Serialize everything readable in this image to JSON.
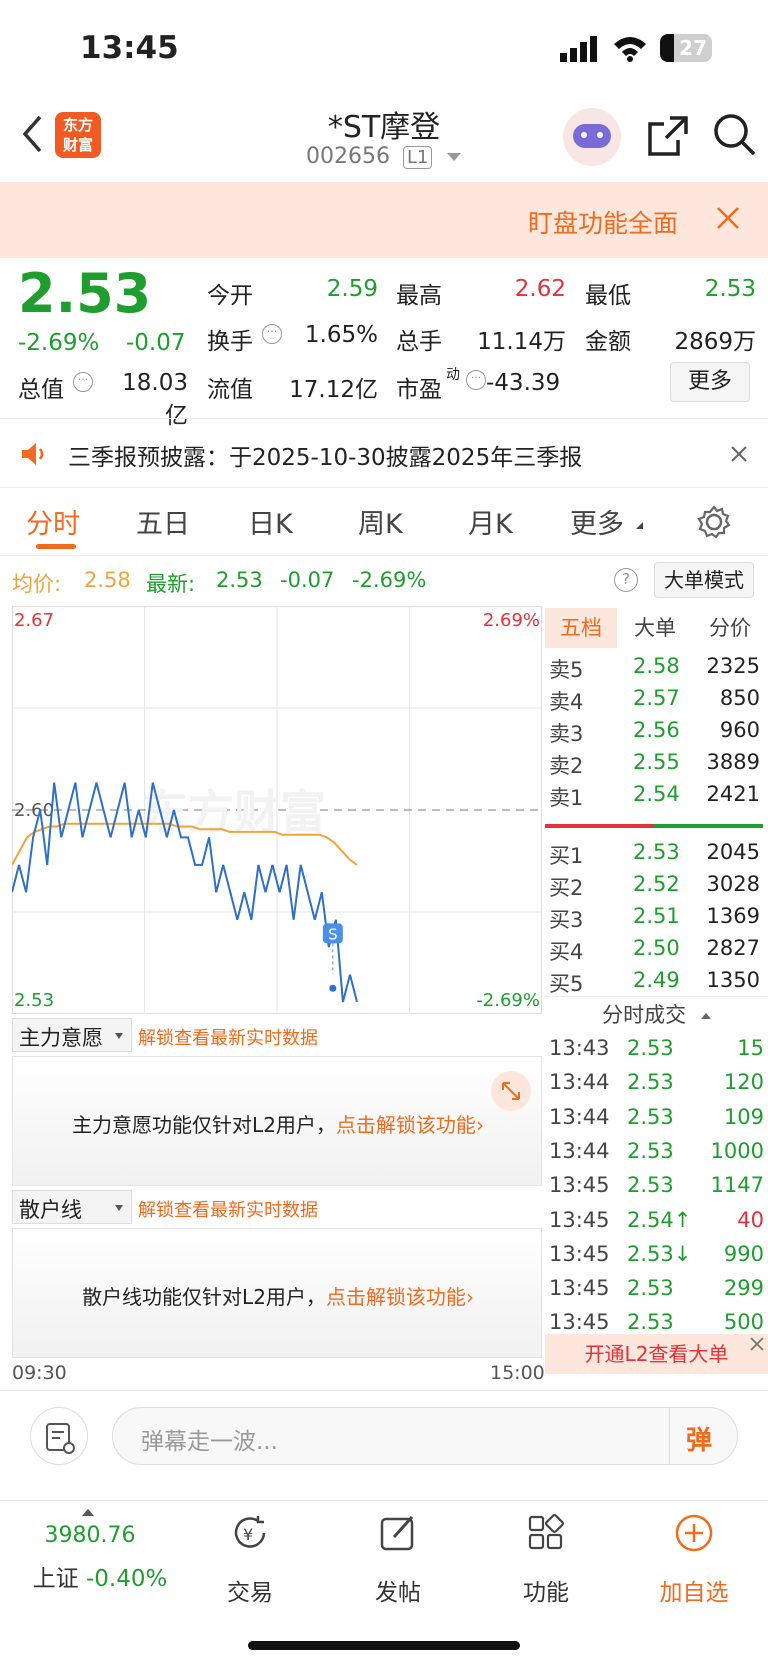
{
  "status": {
    "time": "13:45",
    "battery": "27"
  },
  "header": {
    "title": "*ST摩登",
    "code": "002656",
    "level": "L1",
    "logo_line1": "东方",
    "logo_line2": "财富"
  },
  "banner": {
    "text": "盯盘功能全面"
  },
  "quote": {
    "price": "2.53",
    "change_pct": "-2.69%",
    "change": "-0.07",
    "open_label": "今开",
    "open": "2.59",
    "high_label": "最高",
    "high": "2.62",
    "low_label": "最低",
    "low": "2.53",
    "turnover_label": "换手",
    "turnover": "1.65%",
    "volume_label": "总手",
    "volume": "11.14万",
    "amount_label": "金额",
    "amount": "2869万",
    "mktcap_label": "总值",
    "mktcap": "18.03亿",
    "float_label": "流值",
    "float": "17.12亿",
    "pe_label": "市盈",
    "pe_sup": "动",
    "pe": "-43.39",
    "more_label": "更多"
  },
  "notice": {
    "text": "三季报预披露：于2025-10-30披露2025年三季报"
  },
  "tabs": [
    "分时",
    "五日",
    "日K",
    "周K",
    "月K",
    "更多"
  ],
  "avgline": {
    "avg_label": "均价:",
    "avg": "2.58",
    "last_label": "最新:",
    "last": "2.53",
    "chg": "-0.07",
    "pct": "-2.69%",
    "mode_label": "大单模式"
  },
  "chart": {
    "top_price": "2.67",
    "top_pct": "2.69%",
    "mid_price": "2.60",
    "bottom_price": "2.53",
    "bottom_pct": "-2.69%",
    "start_time": "09:30",
    "end_time": "15:00",
    "watermark": "东方财富",
    "marker": "S"
  },
  "chart_data": {
    "type": "line",
    "ylim": [
      2.53,
      2.67
    ],
    "prev_close": 2.6,
    "series": [
      {
        "values": [
          2.57,
          2.58,
          2.57,
          2.59,
          2.6,
          2.58,
          2.61,
          2.59,
          2.6,
          2.61,
          2.59,
          2.6,
          2.61,
          2.6,
          2.59,
          2.6,
          2.61,
          2.59,
          2.6,
          2.59,
          2.61,
          2.6,
          2.59,
          2.6,
          2.59,
          2.59,
          2.58,
          2.58,
          2.59,
          2.57,
          2.58,
          2.57,
          2.56,
          2.57,
          2.56,
          2.58,
          2.57,
          2.58,
          2.57,
          2.58,
          2.56,
          2.58,
          2.57,
          2.56,
          2.57,
          2.55,
          2.56,
          2.53,
          2.54,
          2.53
        ]
      },
      {
        "values": [
          2.58,
          2.585,
          2.59,
          2.592,
          2.593,
          2.594,
          2.594,
          2.595,
          2.595,
          2.595,
          2.595,
          2.595,
          2.595,
          2.595,
          2.595,
          2.595,
          2.595,
          2.595,
          2.595,
          2.595,
          2.595,
          2.595,
          2.594,
          2.594,
          2.594,
          2.593,
          2.593,
          2.593,
          2.593,
          2.592,
          2.592,
          2.592,
          2.592,
          2.592,
          2.592,
          2.592,
          2.591,
          2.591,
          2.591,
          2.591,
          2.591,
          2.591,
          2.59,
          2.588,
          2.585,
          2.582,
          2.58
        ]
      }
    ]
  },
  "orderbook": {
    "tabs": [
      "五档",
      "大单",
      "分价"
    ],
    "asks": [
      {
        "label": "卖5",
        "price": "2.58",
        "vol": "2325"
      },
      {
        "label": "卖4",
        "price": "2.57",
        "vol": "850"
      },
      {
        "label": "卖3",
        "price": "2.56",
        "vol": "960"
      },
      {
        "label": "卖2",
        "price": "2.55",
        "vol": "3889"
      },
      {
        "label": "卖1",
        "price": "2.54",
        "vol": "2421"
      }
    ],
    "bids": [
      {
        "label": "买1",
        "price": "2.53",
        "vol": "2045"
      },
      {
        "label": "买2",
        "price": "2.52",
        "vol": "3028"
      },
      {
        "label": "买3",
        "price": "2.51",
        "vol": "1369"
      },
      {
        "label": "买4",
        "price": "2.50",
        "vol": "2827"
      },
      {
        "label": "买5",
        "price": "2.49",
        "vol": "1350"
      }
    ],
    "ratio_red": 0.5
  },
  "ticks": {
    "title": "分时成交",
    "rows": [
      {
        "t": "13:43",
        "p": "2.53",
        "v": "15"
      },
      {
        "t": "13:44",
        "p": "2.53",
        "v": "120"
      },
      {
        "t": "13:44",
        "p": "2.53",
        "v": "109"
      },
      {
        "t": "13:44",
        "p": "2.53",
        "v": "1000"
      },
      {
        "t": "13:45",
        "p": "2.53",
        "v": "1147"
      },
      {
        "t": "13:45",
        "p": "2.54↑",
        "v": "40"
      },
      {
        "t": "13:45",
        "p": "2.53↓",
        "v": "990"
      },
      {
        "t": "13:45",
        "p": "2.53",
        "v": "299"
      },
      {
        "t": "13:45",
        "p": "2.53",
        "v": "500"
      }
    ],
    "l2_promo": "开通L2查看大单"
  },
  "panels": {
    "p1_select": "主力意愿",
    "p1_unlock": "解锁查看最新实时数据",
    "p1_msg": "主力意愿功能仅针对L2用户，",
    "p1_link": "点击解锁该功能",
    "p2_select": "散户线",
    "p2_unlock": "解锁查看最新实时数据",
    "p2_msg": "散户线功能仅针对L2用户，",
    "p2_link": "点击解锁该功能"
  },
  "danmu": {
    "placeholder": "弹幕走一波...",
    "send": "弹"
  },
  "bottom": {
    "index_value": "3980.76",
    "index_name": "上证",
    "index_pct": "-0.40%",
    "trade": "交易",
    "post": "发帖",
    "func": "功能",
    "add": "加自选"
  }
}
